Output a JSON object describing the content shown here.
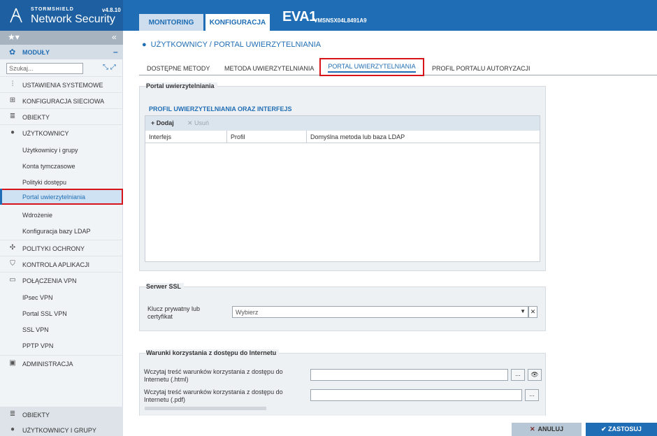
{
  "header": {
    "brand": "STORMSHIELD",
    "product": "Network Security",
    "version": "v4.8.10",
    "tabs": [
      "MONITORING",
      "KONFIGURACJA"
    ],
    "firewall_name": "EVA1",
    "serial": "VMSNSX04L8491A9"
  },
  "sidebar": {
    "modules_label": "MODUŁY",
    "search_placeholder": "Szukaj...",
    "items": [
      {
        "label": "USTAWIENIA SYSTEMOWE",
        "icon": "settings-sliders-icon"
      },
      {
        "label": "KONFIGURACJA SIECIOWA",
        "icon": "network-icon"
      },
      {
        "label": "OBIEKTY",
        "icon": "database-icon"
      },
      {
        "label": "UŻYTKOWNICY",
        "icon": "user-icon"
      }
    ],
    "users_sub": [
      "Użytkownicy i grupy",
      "Konta tymczasowe",
      "Polityki dostępu",
      "Portal uwierzytelniania",
      "Wdrożenie",
      "Konfiguracja bazy LDAP"
    ],
    "items2": [
      {
        "label": "POLITYKI OCHRONY",
        "icon": "policy-icon"
      },
      {
        "label": "KONTROLA APLIKACJI",
        "icon": "shield-icon"
      },
      {
        "label": "POŁĄCZENIA VPN",
        "icon": "vpn-icon"
      }
    ],
    "vpn_sub": [
      "IPsec VPN",
      "Portal SSL VPN",
      "SSL VPN",
      "PPTP VPN"
    ],
    "admin_label": "ADMINISTRACJA",
    "bottom": [
      "OBIEKTY",
      "UŻYTKOWNICY I GRUPY"
    ]
  },
  "main": {
    "title": "UŻYTKOWNICY / PORTAL UWIERZYTELNIANIA",
    "tabs": [
      "DOSTĘPNE METODY",
      "METODA UWIERZYTELNIANIA",
      "PORTAL UWIERZYTELNIANIA",
      "PROFIL PORTALU AUTORYZACJI"
    ],
    "portal": {
      "title": "Portal uwierzytelniania",
      "section": "PROFIL UWIERZYTELNIANIA ORAZ INTERFEJS",
      "add": "Dodaj",
      "remove": "Usuń",
      "columns": [
        "Interfejs",
        "Profil",
        "Domyślna metoda lub baza LDAP"
      ]
    },
    "ssl": {
      "title": "Serwer SSL",
      "label_line1": "Klucz prywatny lub",
      "label_line2": "certyfikat",
      "select_value": "Wybierz"
    },
    "terms": {
      "title": "Warunki korzystania z dostępu do Internetu",
      "html_line1": "Wczytaj treść warunków korzystania z dostępu do",
      "html_line2": "Internetu (.html)",
      "pdf_line1": "Wczytaj treść warunków korzystania z dostępu do",
      "pdf_line2": "Internetu (.pdf)",
      "browse": "..."
    }
  },
  "footer": {
    "cancel": "ANULUJ",
    "apply": "ZASTOSUJ"
  }
}
